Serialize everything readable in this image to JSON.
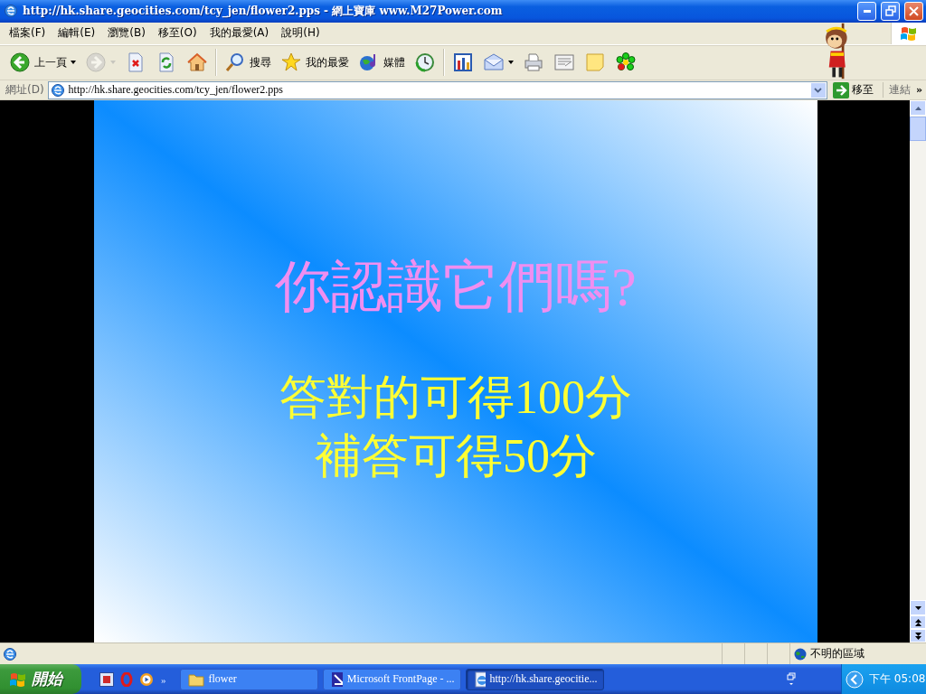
{
  "window": {
    "title": "http://hk.share.geocities.com/tcy_jen/flower2.pps - 網上寶庫 www.M27Power.com"
  },
  "menu": [
    "檔案(F)",
    "編輯(E)",
    "瀏覽(B)",
    "移至(O)",
    "我的最愛(A)",
    "說明(H)"
  ],
  "toolbar_groups": [
    {
      "buttons": [
        {
          "label": "上一頁",
          "dropdown": true,
          "disabled": false
        },
        {
          "dropdown": true,
          "disabled": true
        },
        {
          "dropdown": false,
          "disabled": false
        },
        {
          "dropdown": false,
          "disabled": false
        },
        {
          "dropdown": false,
          "disabled": false
        }
      ]
    },
    {
      "buttons": [
        {
          "label": "搜尋",
          "dropdown": false,
          "disabled": false
        },
        {
          "label": "我的最愛",
          "dropdown": false,
          "disabled": false
        },
        {
          "label": "媒體",
          "dropdown": false,
          "disabled": false
        },
        {
          "dropdown": false,
          "disabled": false
        }
      ]
    },
    {
      "buttons": [
        {
          "dropdown": false,
          "disabled": false
        },
        {
          "dropdown": true,
          "disabled": false
        },
        {
          "dropdown": false,
          "disabled": false
        },
        {
          "dropdown": false,
          "disabled": false
        },
        {
          "dropdown": false,
          "disabled": false
        },
        {
          "dropdown": false,
          "disabled": false
        }
      ]
    }
  ],
  "address": {
    "label": "網址(D)",
    "url": "http://hk.share.geocities.com/tcy_jen/flower2.pps",
    "go": "移至",
    "links": "連結",
    "more": "»"
  },
  "slide": {
    "title": "你認識它們嗎?",
    "lines": [
      "答對的可得100分",
      "補答可得50分"
    ]
  },
  "status": {
    "zone": "不明的區域"
  },
  "taskbar": {
    "start": "開始",
    "more": "»",
    "tasks": [
      {
        "label": "flower",
        "selected": false
      },
      {
        "label": "Microsoft FrontPage - ...",
        "selected": false
      },
      {
        "label": "http://hk.share.geocitie...",
        "selected": true
      }
    ],
    "clock": "下午 05:08"
  }
}
